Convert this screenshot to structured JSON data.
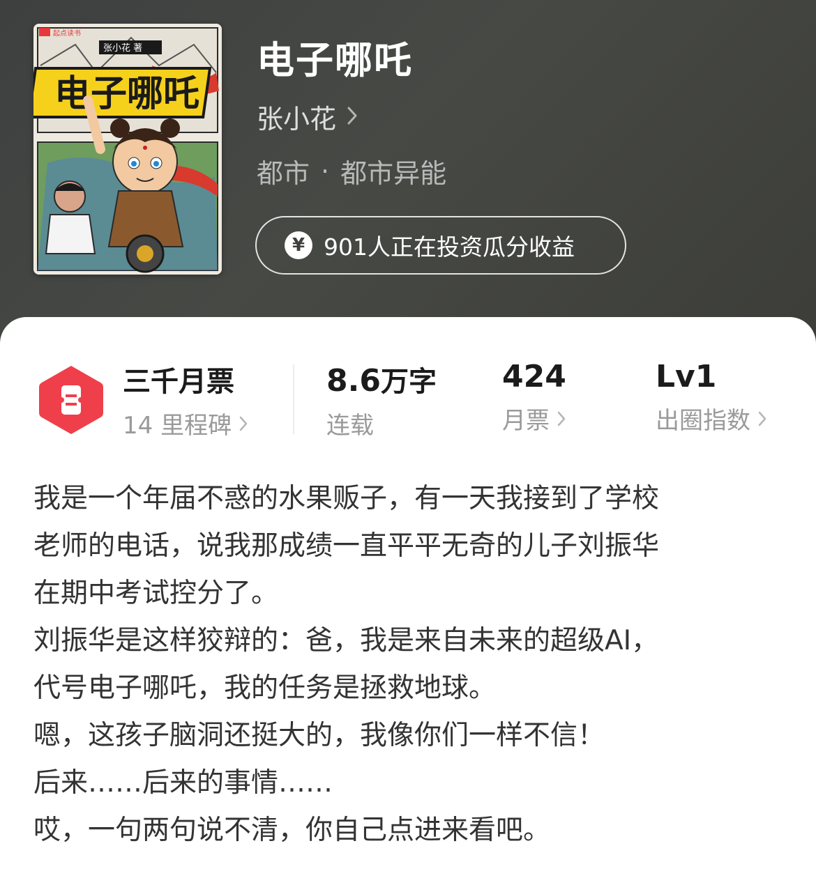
{
  "book": {
    "title": "电子哪吒",
    "author": "张小花",
    "category": "都市",
    "separator": "·",
    "subcategory": "都市异能",
    "invest_text": "901人正在投资瓜分收益",
    "cover": {
      "publisher_logo": "起点读书",
      "author_mark": "张小花 著",
      "title_art": "电子哪吒"
    }
  },
  "stats": {
    "ticket": {
      "title": "三千月票",
      "sub": "14 里程碑"
    },
    "words": {
      "value": "8.6",
      "unit": "万字",
      "sub": "连载"
    },
    "monthly": {
      "value": "424",
      "sub": "月票"
    },
    "level": {
      "value": "Lv1",
      "sub": "出圈指数"
    }
  },
  "description": [
    "我是一个年届不惑的水果贩子，有一天我接到了学校",
    "老师的电话，说我那成绩一直平平无奇的儿子刘振华",
    "在期中考试控分了。",
    "刘振华是这样狡辩的：爸，我是来自未来的超级AI，",
    "代号电子哪吒，我的任务是拯救地球。",
    "嗯，这孩子脑洞还挺大的，我像你们一样不信！",
    "后来……后来的事情……",
    "哎，一句两句说不清，你自己点进来看吧。"
  ],
  "icons": {
    "yen": "yen-icon",
    "chevron": "chevron-right-icon",
    "ticket": "ticket-icon"
  },
  "colors": {
    "header_bg": "#424340",
    "ticket_red": "#ef3f4a",
    "text_dark": "#1b1b1b",
    "text_muted": "#9a9a9a"
  }
}
